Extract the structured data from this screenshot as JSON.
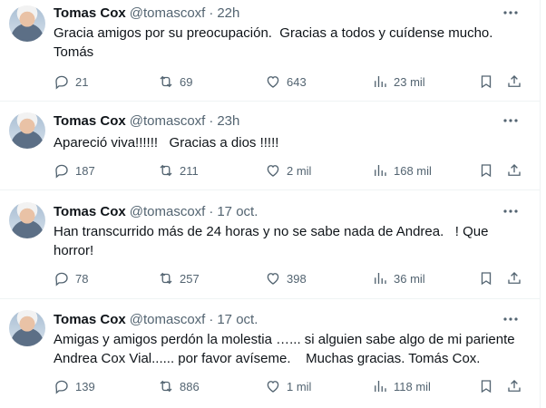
{
  "tweets": [
    {
      "name": "Tomas Cox",
      "handle": "@tomascoxf",
      "separator": "·",
      "time": "22h",
      "text": "Gracia amigos por su preocupación.  Gracias a todos y cuídense mucho.\nTomás",
      "replies": "21",
      "retweets": "69",
      "likes": "643",
      "views": "23 mil"
    },
    {
      "name": "Tomas Cox",
      "handle": "@tomascoxf",
      "separator": "·",
      "time": "23h",
      "text": "Apareció viva!!!!!!   Gracias a dios !!!!!",
      "replies": "187",
      "retweets": "211",
      "likes": "2 mil",
      "views": "168 mil"
    },
    {
      "name": "Tomas Cox",
      "handle": "@tomascoxf",
      "separator": "·",
      "time": "17 oct.",
      "text": "Han transcurrido más de 24 horas y no se sabe nada de Andrea.   ! Que horror!",
      "replies": "78",
      "retweets": "257",
      "likes": "398",
      "views": "36 mil"
    },
    {
      "name": "Tomas Cox",
      "handle": "@tomascoxf",
      "separator": "·",
      "time": "17 oct.",
      "text": "Amigas y amigos perdón la molestia …... si alguien sabe algo de mi pariente Andrea Cox Vial...... por favor avíseme.    Muchas gracias. Tomás Cox.",
      "replies": "139",
      "retweets": "886",
      "likes": "1 mil",
      "views": "118 mil"
    }
  ],
  "icons": {
    "more": "more-dots-icon",
    "reply": "reply-bubble-icon",
    "retweet": "retweet-arrows-icon",
    "like": "heart-icon",
    "views": "views-bars-icon",
    "bookmark": "bookmark-icon",
    "share": "share-upload-icon"
  },
  "colors": {
    "text": "#0f1419",
    "secondary": "#536471",
    "divider": "#eff3f4"
  }
}
